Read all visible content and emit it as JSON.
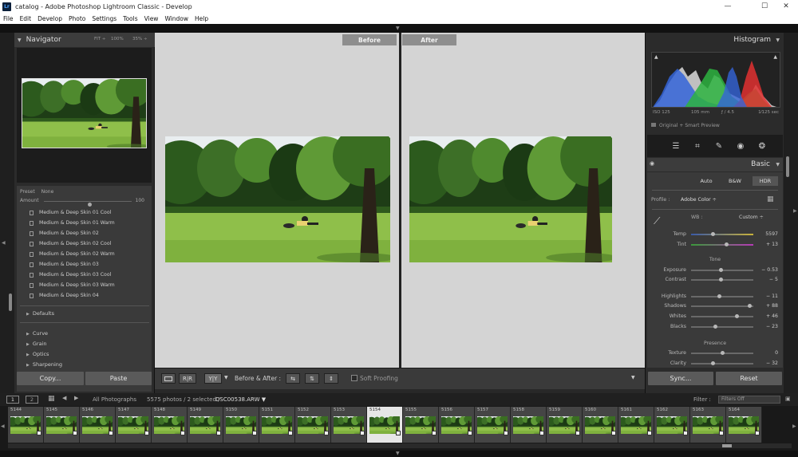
{
  "window": {
    "app_icon": "Lr",
    "title": "catalog - Adobe Photoshop Lightroom Classic - Develop",
    "minimize_glyph": "—",
    "maximize_glyph": "☐",
    "close_glyph": "✕"
  },
  "menu": [
    "File",
    "Edit",
    "Develop",
    "Photo",
    "Settings",
    "Tools",
    "View",
    "Window",
    "Help"
  ],
  "navigator": {
    "title": "Navigator",
    "zoom_options": [
      "FIT ÷",
      "100%",
      "35% ÷"
    ]
  },
  "preset_panel": {
    "preset_label": "Preset",
    "preset_value": "None",
    "amount_label": "Amount",
    "amount_value": "100",
    "amount_fraction": 0.5,
    "items": [
      "Medium & Deep Skin 01 Cool",
      "Medium & Deep Skin 01 Warm",
      "Medium & Deep Skin 02",
      "Medium & Deep Skin 02 Cool",
      "Medium & Deep Skin 02 Warm",
      "Medium & Deep Skin 03",
      "Medium & Deep Skin 03 Cool",
      "Medium & Deep Skin 03 Warm",
      "Medium & Deep Skin 04"
    ],
    "groups": [
      "Defaults",
      "Curve",
      "Grain",
      "Optics",
      "Sharpening"
    ]
  },
  "left_buttons": {
    "copy": "Copy...",
    "paste": "Paste"
  },
  "compare": {
    "before_label": "Before",
    "after_label": "After"
  },
  "toolbar": {
    "view_single": "",
    "view_compare": "R|R",
    "view_yy": "Y|Y",
    "ba_label": "Before & After :",
    "swap_1": "⇆",
    "swap_2": "⇅",
    "swap_3": "⇕",
    "soft_proofing": "Soft Proofing",
    "arrow": "▼"
  },
  "histogram": {
    "title": "Histogram",
    "iso": "ISO 125",
    "focal": "105 mm",
    "aperture": "ƒ / 4.5",
    "shutter": "1⁄125 sec",
    "mode": "Original + Smart Preview"
  },
  "basic": {
    "title": "Basic",
    "modes": [
      "Auto",
      "B&W",
      "HDR"
    ],
    "profile_label": "Profile :",
    "profile_value": "Adobe Color ÷",
    "wb_label": "WB :",
    "wb_value": "Custom ÷",
    "tone_label": "Tone",
    "presence_label": "Presence",
    "sliders": [
      {
        "label": "Temp",
        "value": "5597",
        "pos": 0.35
      },
      {
        "label": "Tint",
        "value": "+ 13",
        "pos": 0.56
      },
      {
        "label": "Exposure",
        "value": "− 0.53",
        "pos": 0.47
      },
      {
        "label": "Contrast",
        "value": "− 5",
        "pos": 0.48
      },
      {
        "label": "Highlights",
        "value": "− 11",
        "pos": 0.45
      },
      {
        "label": "Shadows",
        "value": "+ 88",
        "pos": 0.94
      },
      {
        "label": "Whites",
        "value": "+ 46",
        "pos": 0.73
      },
      {
        "label": "Blacks",
        "value": "− 23",
        "pos": 0.39
      },
      {
        "label": "Texture",
        "value": "0",
        "pos": 0.5
      },
      {
        "label": "Clarity",
        "value": "− 32",
        "pos": 0.34
      }
    ]
  },
  "right_buttons": {
    "sync": "Sync...",
    "reset": "Reset"
  },
  "filmstrip_bar": {
    "view1": "1",
    "view2": "2",
    "source": "All Photographs",
    "count": "5575 photos / 2 selected /",
    "filename": "DSC00538.ARW ▼",
    "filter_label": "Filter :",
    "filter_value": "Filters Off"
  },
  "filmstrip": {
    "cells": [
      {
        "num": "5144"
      },
      {
        "num": "5145"
      },
      {
        "num": "5146"
      },
      {
        "num": "5147"
      },
      {
        "num": "5148"
      },
      {
        "num": "5149"
      },
      {
        "num": "5150"
      },
      {
        "num": "5151"
      },
      {
        "num": "5152"
      },
      {
        "num": "5153"
      },
      {
        "num": "5154"
      },
      {
        "num": "5155"
      },
      {
        "num": "5156"
      },
      {
        "num": "5157"
      },
      {
        "num": "5158"
      },
      {
        "num": "5159"
      },
      {
        "num": "5160"
      },
      {
        "num": "5161"
      },
      {
        "num": "5162"
      },
      {
        "num": "5163"
      },
      {
        "num": "5164"
      }
    ],
    "selected_index": 10
  },
  "colors": {
    "panel": "#2b2b2b",
    "canvas": "#d4d4d4",
    "accent_selected": "#e6e6e6"
  }
}
